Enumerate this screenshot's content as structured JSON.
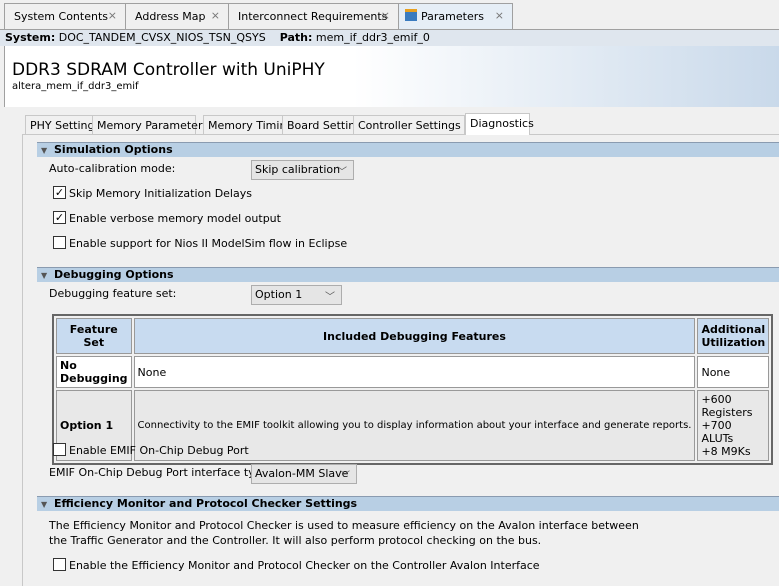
{
  "top_tabs": [
    {
      "label": "System Contents"
    },
    {
      "label": "Address Map"
    },
    {
      "label": "Interconnect Requirements"
    },
    {
      "label": "Parameters"
    }
  ],
  "path_bar": {
    "system_label": "System:",
    "system_value": "DOC_TANDEM_CVSX_NIOS_TSN_QSYS",
    "path_label": "Path:",
    "path_value": "mem_if_ddr3_emif_0"
  },
  "header": {
    "title": "DDR3 SDRAM Controller with UniPHY",
    "subtitle": "altera_mem_if_ddr3_emif"
  },
  "inner_tabs": [
    {
      "label": "PHY Settings"
    },
    {
      "label": "Memory Parameters"
    },
    {
      "label": "Memory Timing"
    },
    {
      "label": "Board Settings"
    },
    {
      "label": "Controller Settings"
    },
    {
      "label": "Diagnostics"
    }
  ],
  "simulation": {
    "title": "Simulation Options",
    "calib_label": "Auto-calibration mode:",
    "calib_value": "Skip calibration",
    "checkboxes": [
      {
        "label": "Skip Memory Initialization Delays",
        "checked": true
      },
      {
        "label": "Enable verbose memory model output",
        "checked": true
      },
      {
        "label": "Enable support for Nios II ModelSim flow in Eclipse",
        "checked": false
      }
    ]
  },
  "debugging": {
    "title": "Debugging Options",
    "feature_label": "Debugging feature set:",
    "feature_value": "Option 1",
    "table": {
      "headers": [
        "Feature Set",
        "Included Debugging Features",
        "Additional Utilization"
      ],
      "rows": [
        [
          "No Debugging",
          "None",
          "None"
        ],
        [
          "Option 1",
          "Connectivity to the EMIF toolkit allowing you to display information about your interface and generate reports.",
          "+600 Registers",
          "+700 ALUTs",
          "+8 M9Ks"
        ]
      ]
    },
    "debug_port_label": "Enable EMIF On-Chip Debug Port",
    "debug_port_checked": false,
    "iface_label": "EMIF On-Chip Debug Port interface type:",
    "iface_value": "Avalon-MM Slave"
  },
  "efficiency": {
    "title": "Efficiency Monitor and Protocol Checker Settings",
    "desc1": "The Efficiency Monitor and Protocol Checker is used to measure efficiency on the Avalon interface between",
    "desc2": "the Traffic Generator and the Controller. It will also perform protocol checking on the bus.",
    "enable_label": "Enable the Efficiency Monitor and Protocol Checker on the Controller Avalon Interface",
    "enable_checked": false
  }
}
